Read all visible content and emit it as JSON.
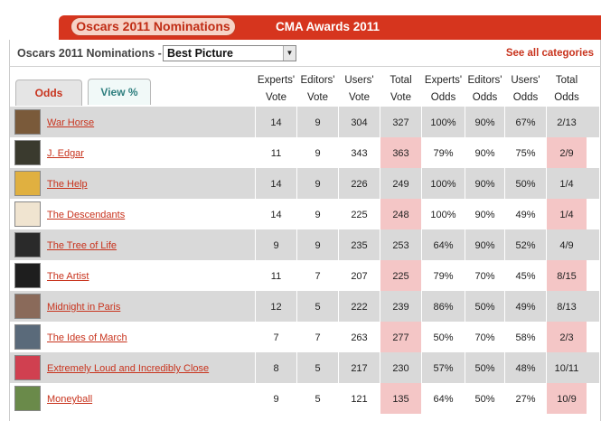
{
  "nav": {
    "tabs": [
      {
        "label": "Oscars 2011 Nominations",
        "active": true
      },
      {
        "label": "CMA Awards 2011",
        "active": false
      }
    ]
  },
  "category": {
    "label": "Oscars 2011 Nominations -",
    "selected": "Best Picture",
    "see_all": "See all categories"
  },
  "view_tabs": [
    {
      "label": "Odds",
      "active": true
    },
    {
      "label": "View %",
      "active": false
    }
  ],
  "columns": [
    [
      "Experts'",
      "Vote"
    ],
    [
      "Editors'",
      "Vote"
    ],
    [
      "Users'",
      "Vote"
    ],
    [
      "Total",
      "Vote"
    ],
    [
      "Experts'",
      "Odds"
    ],
    [
      "Editors'",
      "Odds"
    ],
    [
      "Users'",
      "Odds"
    ],
    [
      "Total",
      "Odds"
    ]
  ],
  "rows": [
    {
      "title": "War Horse",
      "cells": [
        "14",
        "9",
        "304",
        "327",
        "100%",
        "90%",
        "67%",
        "2/13"
      ]
    },
    {
      "title": "J. Edgar",
      "cells": [
        "11",
        "9",
        "343",
        "363",
        "79%",
        "90%",
        "75%",
        "2/9"
      ]
    },
    {
      "title": "The Help",
      "cells": [
        "14",
        "9",
        "226",
        "249",
        "100%",
        "90%",
        "50%",
        "1/4"
      ]
    },
    {
      "title": "The Descendants",
      "cells": [
        "14",
        "9",
        "225",
        "248",
        "100%",
        "90%",
        "49%",
        "1/4"
      ]
    },
    {
      "title": "The Tree of Life",
      "cells": [
        "9",
        "9",
        "235",
        "253",
        "64%",
        "90%",
        "52%",
        "4/9"
      ]
    },
    {
      "title": "The Artist",
      "cells": [
        "11",
        "7",
        "207",
        "225",
        "79%",
        "70%",
        "45%",
        "8/15"
      ]
    },
    {
      "title": "Midnight in Paris",
      "cells": [
        "12",
        "5",
        "222",
        "239",
        "86%",
        "50%",
        "49%",
        "8/13"
      ]
    },
    {
      "title": "The Ides of March",
      "cells": [
        "7",
        "7",
        "263",
        "277",
        "50%",
        "70%",
        "58%",
        "2/3"
      ]
    },
    {
      "title": "Extremely Loud and Incredibly Close",
      "cells": [
        "8",
        "5",
        "217",
        "230",
        "57%",
        "50%",
        "48%",
        "10/11"
      ]
    },
    {
      "title": "Moneyball",
      "cells": [
        "9",
        "5",
        "121",
        "135",
        "64%",
        "50%",
        "27%",
        "10/9"
      ]
    }
  ],
  "colors": {
    "accent": "#d6351e",
    "link": "#c8331d",
    "row_shade": "#d9d9d9",
    "total_highlight": "#f4c6c6"
  }
}
